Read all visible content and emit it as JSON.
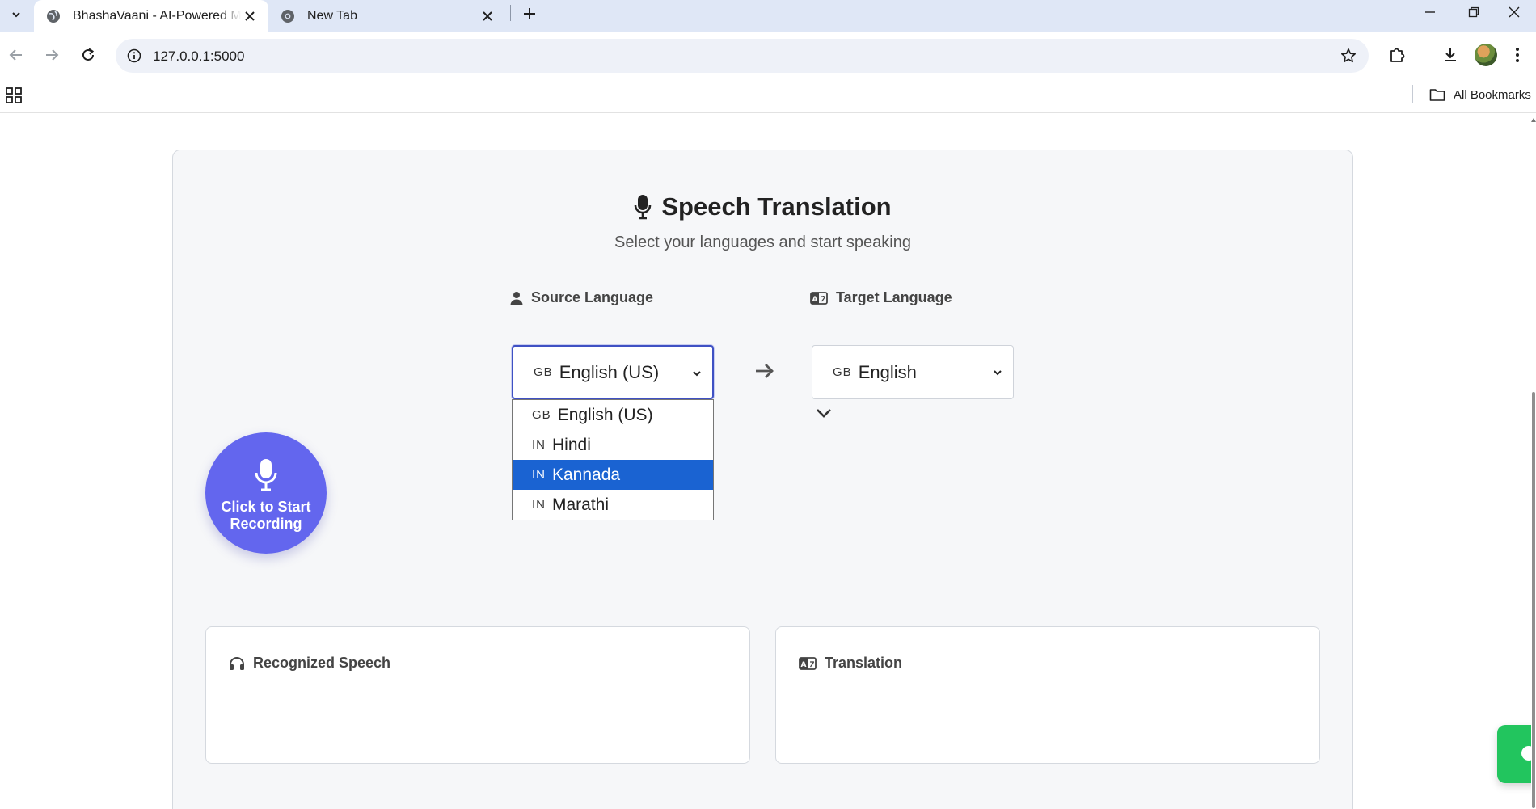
{
  "browser": {
    "tabs": [
      {
        "title": "BhashaVaani - AI-Powered Multi",
        "active": true
      },
      {
        "title": "New Tab",
        "active": false
      }
    ],
    "url": "127.0.0.1:5000",
    "bookmarks_label": "All Bookmarks"
  },
  "page": {
    "title": "Speech Translation",
    "subtitle": "Select your languages and start speaking",
    "source": {
      "label": "Source Language",
      "selected_flag": "GB",
      "selected": "English (US)",
      "options": [
        {
          "flag": "GB",
          "label": "English (US)",
          "highlighted": false
        },
        {
          "flag": "IN",
          "label": "Hindi",
          "highlighted": false
        },
        {
          "flag": "IN",
          "label": "Kannada",
          "highlighted": true
        },
        {
          "flag": "IN",
          "label": "Marathi",
          "highlighted": false
        }
      ]
    },
    "target": {
      "label": "Target Language",
      "selected_flag": "GB",
      "selected": "English"
    },
    "record_button": "Click to Start Recording",
    "panels": {
      "recognized_title": "Recognized Speech",
      "translation_title": "Translation"
    }
  },
  "colors": {
    "accent": "#6366ee",
    "dropdown_highlight": "#1a63d2",
    "chat_button": "#22c55e"
  }
}
